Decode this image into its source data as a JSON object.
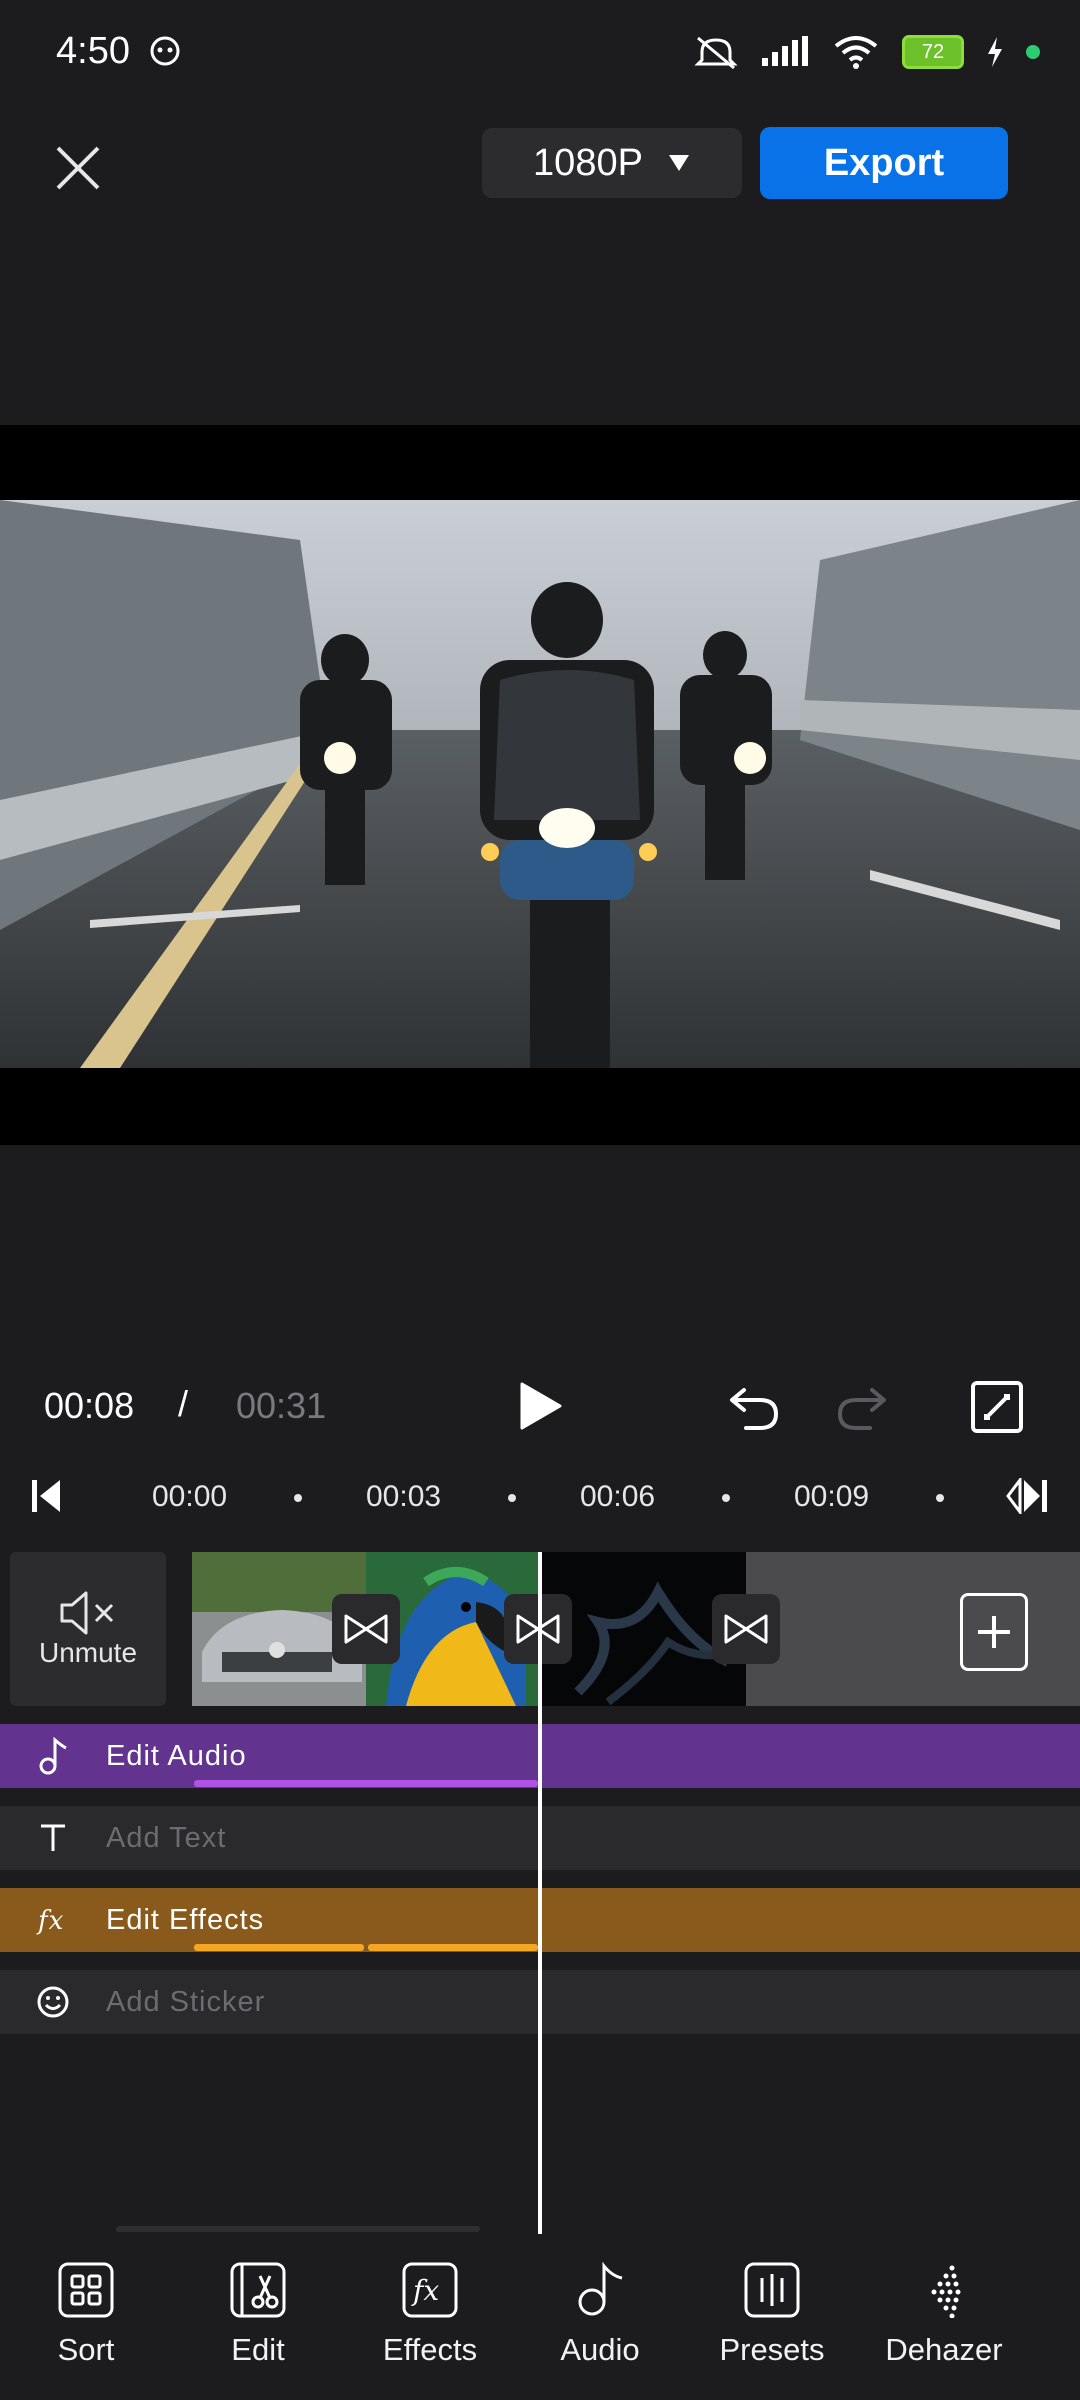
{
  "status_bar": {
    "time": "4:50",
    "battery": "72"
  },
  "top_bar": {
    "resolution": "1080P",
    "export_label": "Export"
  },
  "playback": {
    "current_time": "00:08",
    "separator": "/",
    "total_time": "00:31"
  },
  "ruler": {
    "ticks": [
      "00:00",
      "00:03",
      "00:06",
      "00:09"
    ]
  },
  "video_track": {
    "unmute_label": "Unmute",
    "clips": [
      "car-clip",
      "parrot-clip",
      "smoke-clip"
    ]
  },
  "tracks": {
    "audio_label": "Edit Audio",
    "text_label": "Add Text",
    "effects_label": "Edit Effects",
    "sticker_label": "Add Sticker"
  },
  "bottom_nav": {
    "items": [
      {
        "label": "Sort",
        "icon": "grid-icon"
      },
      {
        "label": "Edit",
        "icon": "film-scissors-icon"
      },
      {
        "label": "Effects",
        "icon": "fx-icon"
      },
      {
        "label": "Audio",
        "icon": "music-note-icon"
      },
      {
        "label": "Presets",
        "icon": "presets-icon"
      },
      {
        "label": "Dehazer",
        "icon": "dehaze-icon"
      }
    ]
  },
  "colors": {
    "accent": "#0a72e8",
    "audio_track": "#62338f",
    "effects_track": "#8a5a1c",
    "background": "#1c1c1e"
  }
}
